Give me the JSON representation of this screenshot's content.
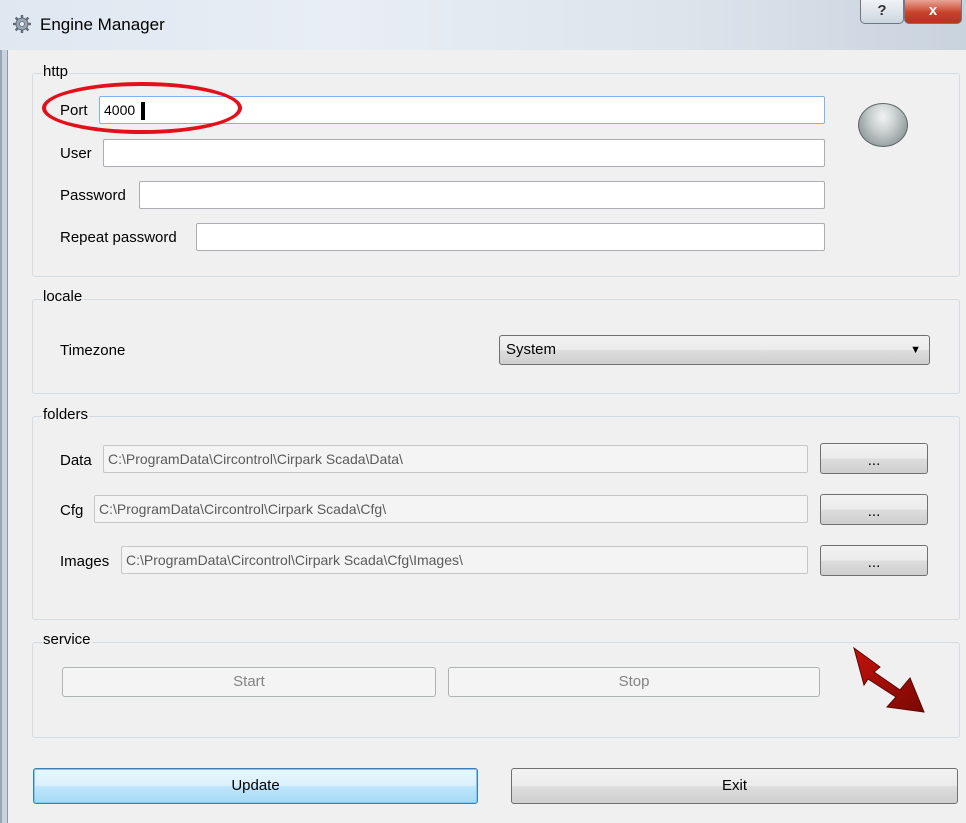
{
  "window": {
    "title": "Engine Manager",
    "help_label": "?",
    "close_label": "x",
    "gear_icon": "gear-icon",
    "accent_color": "#e3101b"
  },
  "http": {
    "group_label": "http",
    "port_label": "Port",
    "port_value": "4000",
    "user_label": "User",
    "user_value": "",
    "password_label": "Password",
    "password_value": "",
    "repeat_password_label": "Repeat password",
    "repeat_password_value": "",
    "status_led": "led-indicator-off"
  },
  "locale": {
    "group_label": "locale",
    "timezone_label": "Timezone",
    "timezone_value": "System"
  },
  "folders": {
    "group_label": "folders",
    "data_label": "Data",
    "data_value": "C:\\ProgramData\\Circontrol\\Cirpark Scada\\Data\\",
    "cfg_label": "Cfg",
    "cfg_value": "C:\\ProgramData\\Circontrol\\Cirpark Scada\\Cfg\\",
    "images_label": "Images",
    "images_value": "C:\\ProgramData\\Circontrol\\Cirpark Scada\\Cfg\\Images\\",
    "browse_label": "..."
  },
  "service": {
    "group_label": "service",
    "start_label": "Start",
    "stop_label": "Stop"
  },
  "footer": {
    "update_label": "Update",
    "exit_label": "Exit"
  }
}
